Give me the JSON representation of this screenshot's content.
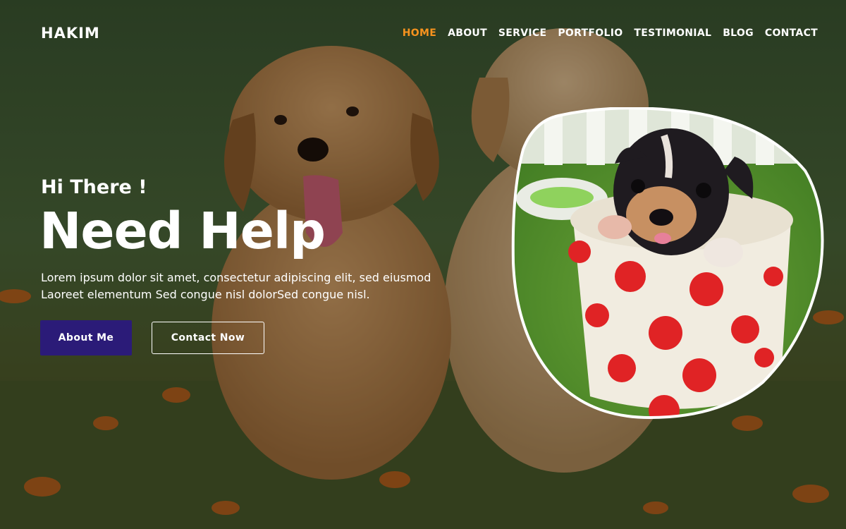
{
  "brand": {
    "logo": "HAKIM"
  },
  "nav": {
    "items": [
      {
        "label": "HOME",
        "active": true
      },
      {
        "label": "ABOUT"
      },
      {
        "label": "SERVICE"
      },
      {
        "label": "PORTFOLIO"
      },
      {
        "label": "TESTIMONIAL"
      },
      {
        "label": "BLOG"
      },
      {
        "label": "CONTACT"
      }
    ]
  },
  "hero": {
    "greeting": "Hi There !",
    "headline": "Need Help",
    "description_line1": "Lorem ipsum dolor sit amet, consectetur adipiscing elit, sed eiusmod",
    "description_line2": "Laoreet elementum Sed congue nisl dolorSed congue nisl.",
    "primary_button": "About Me",
    "secondary_button": "Contact Now"
  },
  "colors": {
    "accent": "#f7931e",
    "primary_button": "#2b1b78",
    "text": "#ffffff"
  }
}
